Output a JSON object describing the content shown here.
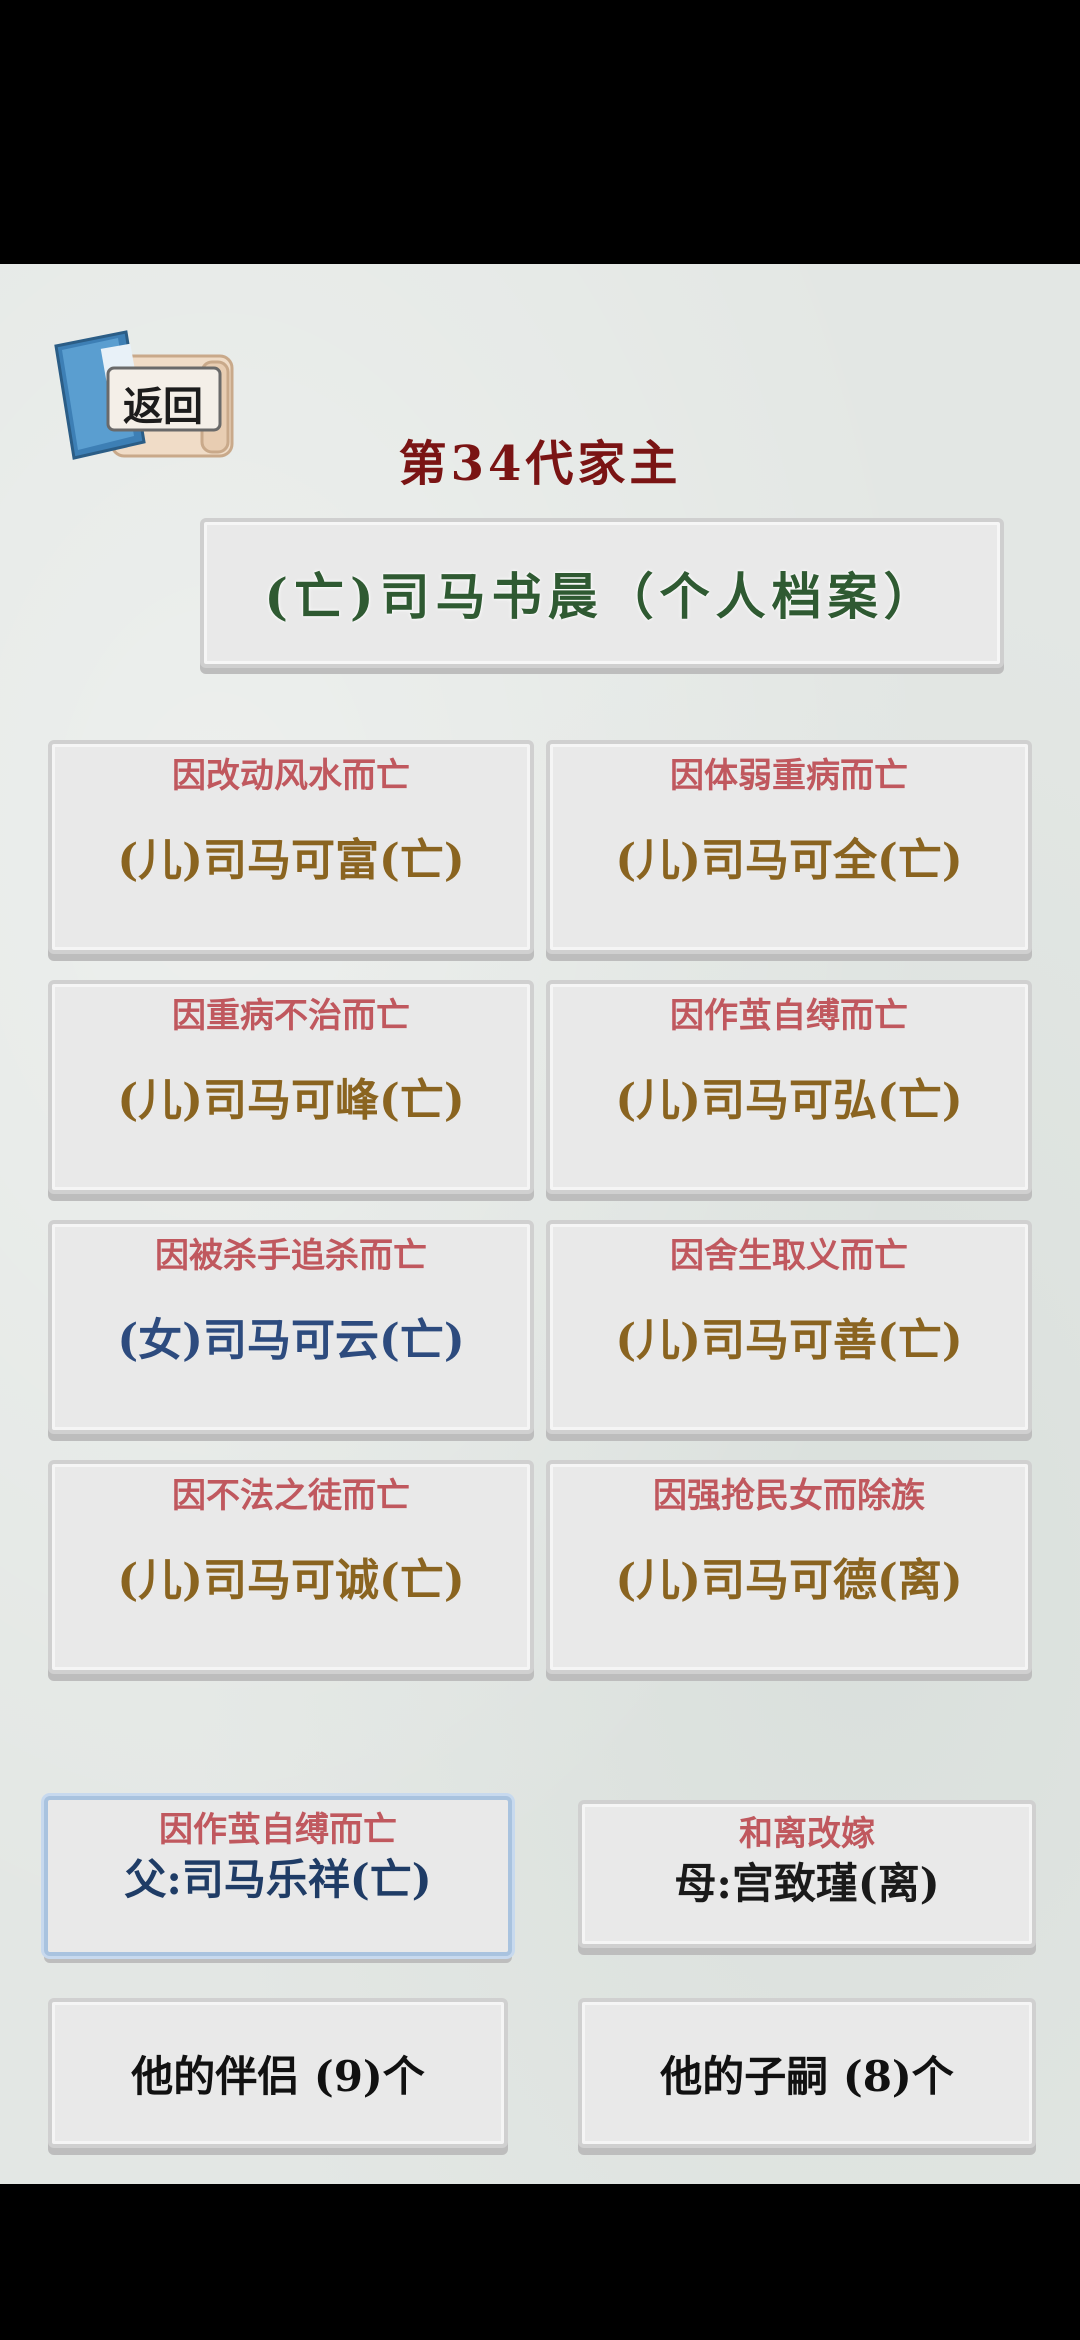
{
  "back_label": "返回",
  "generation_title": "第34代家主",
  "person_banner": "(亡)司马书晨（个人档案）",
  "children": [
    {
      "cause": "因改动风水而亡",
      "name": "(儿)司马可富(亡)"
    },
    {
      "cause": "因体弱重病而亡",
      "name": "(儿)司马可全(亡)"
    },
    {
      "cause": "因重病不治而亡",
      "name": "(儿)司马可峰(亡)"
    },
    {
      "cause": "因作茧自缚而亡",
      "name": "(儿)司马可弘(亡)"
    },
    {
      "cause": "因被杀手追杀而亡",
      "name": "(女)司马可云(亡)"
    },
    {
      "cause": "因舍生取义而亡",
      "name": "(儿)司马可善(亡)"
    },
    {
      "cause": "因不法之徒而亡",
      "name": "(儿)司马可诚(亡)"
    },
    {
      "cause": "因强抢民女而除族",
      "name": "(儿)司马可德(离)"
    }
  ],
  "father": {
    "cause": "因作茧自缚而亡",
    "name": "父:司马乐祥(亡)"
  },
  "mother": {
    "cause": "和离改嫁",
    "name": "母:宫致瑾(离)"
  },
  "partners_button": "他的伴侣 (9)个",
  "heirs_button": "他的子嗣 (8)个",
  "colors": {
    "cause_text": "#c0585e",
    "son_text": "#8a6420",
    "daughter_text": "#2d4b7e",
    "banner_text": "#2f5a32",
    "title_text": "#7a1414"
  }
}
